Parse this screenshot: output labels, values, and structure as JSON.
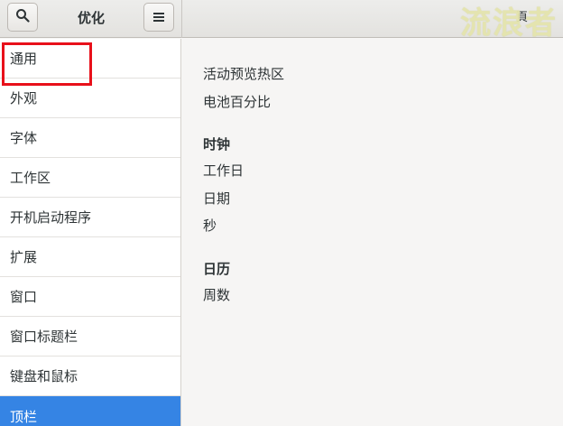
{
  "header": {
    "title": "优化",
    "right_glyph": "頁",
    "watermark": "流浪者"
  },
  "icons": {
    "search": "search-icon",
    "menu": "hamburger-menu-icon"
  },
  "sidebar": {
    "items": [
      {
        "label": "通用"
      },
      {
        "label": "外观"
      },
      {
        "label": "字体"
      },
      {
        "label": "工作区"
      },
      {
        "label": "开机启动程序"
      },
      {
        "label": "扩展"
      },
      {
        "label": "窗口"
      },
      {
        "label": "窗口标题栏"
      },
      {
        "label": "键盘和鼠标"
      },
      {
        "label": "顶栏"
      }
    ],
    "selected_index": 9
  },
  "content": {
    "hot_corner_label": "活动预览热区",
    "battery_percent_label": "电池百分比",
    "clock": {
      "title": "时钟",
      "weekday_label": "工作日",
      "date_label": "日期",
      "seconds_label": "秒"
    },
    "calendar": {
      "title": "日历",
      "week_numbers_label": "周数"
    }
  },
  "colors": {
    "accent": "#3584e4",
    "annotation_red": "#e8101a"
  }
}
